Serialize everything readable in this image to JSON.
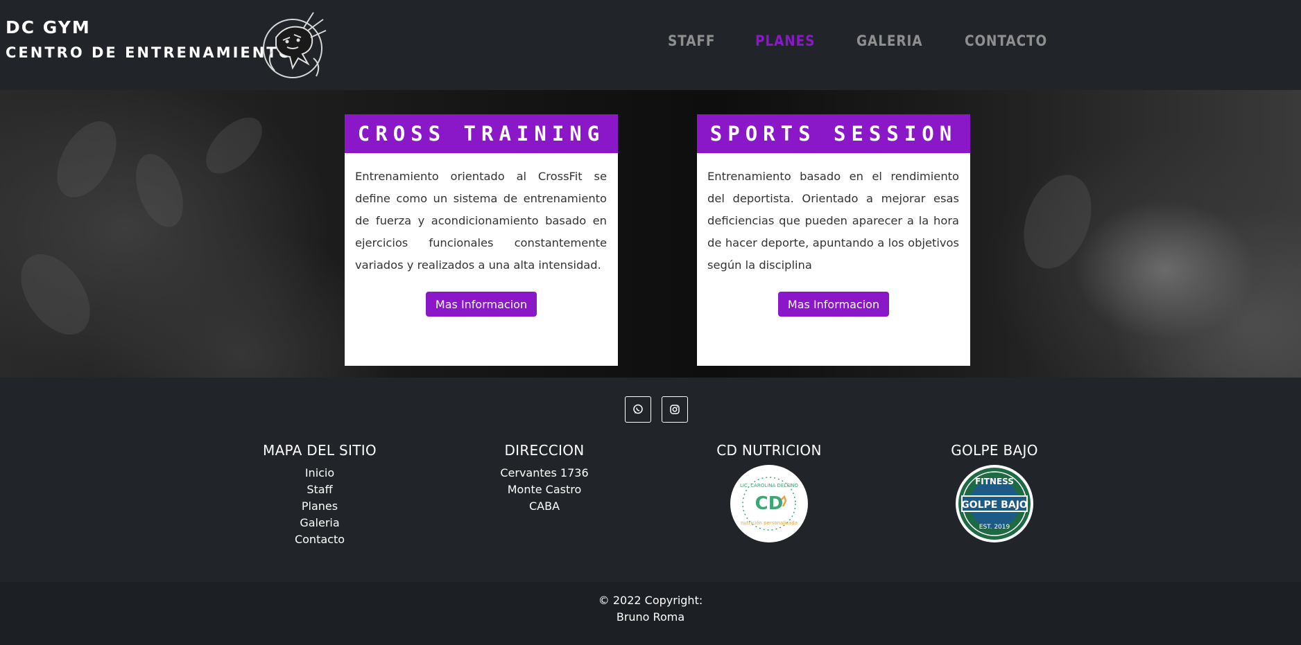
{
  "brand": {
    "line1": "DC GYM",
    "line2": "CENTRO DE ENTRENAMIENTO"
  },
  "nav": [
    {
      "label": "STAFF",
      "active": false
    },
    {
      "label": "PLANES",
      "active": true
    },
    {
      "label": "GALERIA",
      "active": false
    },
    {
      "label": "CONTACTO",
      "active": false
    }
  ],
  "cards": [
    {
      "title": "CROSS TRAINING",
      "text": "Entrenamiento orientado al CrossFit se define como un sistema de entrenamiento de fuerza y acondicionamiento basado en ejercicios funcionales constantemente variados y realizados a una alta intensidad.",
      "button": "Mas Informacion"
    },
    {
      "title": "SPORTS SESSION",
      "text": "Entrenamiento basado en el rendimiento del deportista. Orientado a mejorar esas deficiencias que pueden aparecer a la hora de hacer deporte, apuntando a los objetivos según la disciplina",
      "button": "Mas Informacion"
    }
  ],
  "social": {
    "whatsapp_icon": "whatsapp-icon",
    "instagram_icon": "instagram-icon"
  },
  "footer": {
    "sitemap": {
      "title": "MAPA DEL SITIO",
      "links": [
        "Inicio",
        "Staff",
        "Planes",
        "Galeria",
        "Contacto"
      ]
    },
    "address": {
      "title": "DIRECCION",
      "lines": [
        "Cervantes 1736",
        "Monte Castro",
        "CABA"
      ]
    },
    "nutrition": {
      "title": "CD NUTRICION",
      "logo_top": "LIC. CAROLINA DELFINO",
      "logo_mark": "CD",
      "logo_bottom": "nutrición personalizada"
    },
    "golpe": {
      "title": "GOLPE BAJO",
      "logo_top": "FITNESS",
      "logo_mid": "GOLPE BAJO",
      "logo_bottom": "EST. 2019"
    }
  },
  "copyright": {
    "line1": "© 2022 Copyright:",
    "line2": "Bruno Roma"
  },
  "colors": {
    "accent": "#8a18c9",
    "bg": "#212529",
    "nav_text": "#8f8f8f"
  }
}
